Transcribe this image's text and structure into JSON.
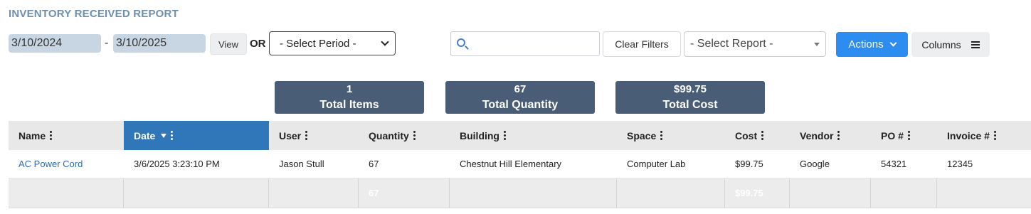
{
  "report": {
    "title": "INVENTORY RECEIVED REPORT"
  },
  "filters": {
    "start_date": "3/10/2024",
    "separator": "-",
    "end_date": "3/10/2025",
    "view_label": "View",
    "or_label": "OR",
    "period_select": "- Select Period -",
    "search_value": "",
    "clear_filters_label": "Clear Filters",
    "report_select": "- Select Report -",
    "actions_label": "Actions",
    "columns_label": "Columns"
  },
  "stats": [
    {
      "value": "1",
      "label": "Total Items"
    },
    {
      "value": "67",
      "label": "Total Quantity"
    },
    {
      "value": "$99.75",
      "label": "Total Cost"
    }
  ],
  "table": {
    "columns": [
      "Name",
      "Date",
      "User",
      "Quantity",
      "Building",
      "Space",
      "Cost",
      "Vendor",
      "PO #",
      "Invoice #"
    ],
    "sorted_column": "Date",
    "sort_direction": "descending",
    "rows": [
      [
        "AC Power Cord",
        "3/6/2025 3:23:10 PM",
        "Jason Stull",
        "67",
        "Chestnut Hill Elementary",
        "Computer Lab",
        "$99.75",
        "Google",
        "54321",
        "12345"
      ]
    ],
    "totals": {
      "quantity": "67",
      "cost": "$99.75"
    }
  },
  "colors": {
    "accent": "#2d8cf0",
    "header_active": "#2f77b8",
    "stat_bg": "#4a5d76",
    "title": "#6f8fb0",
    "link": "#2b6cb0"
  },
  "icons": [
    "search-icon",
    "chevron-down-icon",
    "caret-down-icon",
    "hamburger-menu-icon",
    "kebab-menu-icon",
    "sort-desc-icon"
  ]
}
